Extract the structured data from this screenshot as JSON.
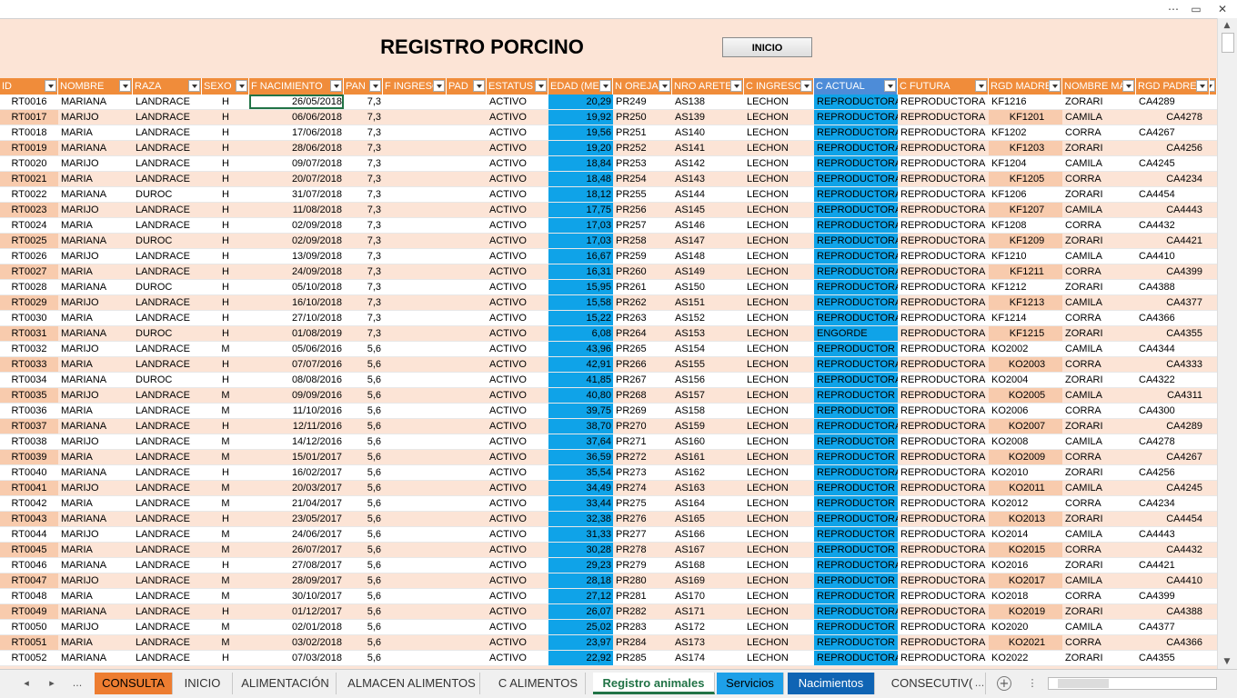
{
  "window": {
    "controls": [
      "⋯",
      "▭",
      "✕"
    ]
  },
  "sheet": {
    "title": "REGISTRO PORCINO",
    "button_label": "INICIO",
    "headers": [
      "ID",
      "NOMBRE",
      "RAZA",
      "SEXO",
      "F NACIMIENTO",
      "PAN",
      "F INGRESO",
      "PAD",
      "ESTATUS",
      "EDAD (ME",
      "N OREJA",
      "NRO ARETE",
      "C INGRESO",
      "C ACTUAL",
      "C FUTURA",
      "RGD MADRE",
      "NOMBRE MA",
      "RGD PADRE",
      ""
    ],
    "rows": [
      [
        "RT0016",
        "MARIANA",
        "LANDRACE",
        "H",
        "26/05/2018",
        "7,3",
        "",
        "",
        "ACTIVO",
        "20,29",
        "PR249",
        "AS138",
        "LECHON",
        "REPRODUCTORA",
        "REPRODUCTORA",
        "KF1216",
        "ZORARI",
        "CA4289"
      ],
      [
        "RT0017",
        "MARIJO",
        "LANDRACE",
        "H",
        "06/06/2018",
        "7,3",
        "",
        "",
        "ACTIVO",
        "19,92",
        "PR250",
        "AS139",
        "LECHON",
        "REPRODUCTORA",
        "REPRODUCTORA",
        "KF1201",
        "CAMILA",
        "CA4278"
      ],
      [
        "RT0018",
        "MARIA",
        "LANDRACE",
        "H",
        "17/06/2018",
        "7,3",
        "",
        "",
        "ACTIVO",
        "19,56",
        "PR251",
        "AS140",
        "LECHON",
        "REPRODUCTORA",
        "REPRODUCTORA",
        "KF1202",
        "CORRA",
        "CA4267"
      ],
      [
        "RT0019",
        "MARIANA",
        "LANDRACE",
        "H",
        "28/06/2018",
        "7,3",
        "",
        "",
        "ACTIVO",
        "19,20",
        "PR252",
        "AS141",
        "LECHON",
        "REPRODUCTORA",
        "REPRODUCTORA",
        "KF1203",
        "ZORARI",
        "CA4256"
      ],
      [
        "RT0020",
        "MARIJO",
        "LANDRACE",
        "H",
        "09/07/2018",
        "7,3",
        "",
        "",
        "ACTIVO",
        "18,84",
        "PR253",
        "AS142",
        "LECHON",
        "REPRODUCTORA",
        "REPRODUCTORA",
        "KF1204",
        "CAMILA",
        "CA4245"
      ],
      [
        "RT0021",
        "MARIA",
        "LANDRACE",
        "H",
        "20/07/2018",
        "7,3",
        "",
        "",
        "ACTIVO",
        "18,48",
        "PR254",
        "AS143",
        "LECHON",
        "REPRODUCTORA",
        "REPRODUCTORA",
        "KF1205",
        "CORRA",
        "CA4234"
      ],
      [
        "RT0022",
        "MARIANA",
        "DUROC",
        "H",
        "31/07/2018",
        "7,3",
        "",
        "",
        "ACTIVO",
        "18,12",
        "PR255",
        "AS144",
        "LECHON",
        "REPRODUCTORA",
        "REPRODUCTORA",
        "KF1206",
        "ZORARI",
        "CA4454"
      ],
      [
        "RT0023",
        "MARIJO",
        "LANDRACE",
        "H",
        "11/08/2018",
        "7,3",
        "",
        "",
        "ACTIVO",
        "17,75",
        "PR256",
        "AS145",
        "LECHON",
        "REPRODUCTORA",
        "REPRODUCTORA",
        "KF1207",
        "CAMILA",
        "CA4443"
      ],
      [
        "RT0024",
        "MARIA",
        "LANDRACE",
        "H",
        "02/09/2018",
        "7,3",
        "",
        "",
        "ACTIVO",
        "17,03",
        "PR257",
        "AS146",
        "LECHON",
        "REPRODUCTORA",
        "REPRODUCTORA",
        "KF1208",
        "CORRA",
        "CA4432"
      ],
      [
        "RT0025",
        "MARIANA",
        "DUROC",
        "H",
        "02/09/2018",
        "7,3",
        "",
        "",
        "ACTIVO",
        "17,03",
        "PR258",
        "AS147",
        "LECHON",
        "REPRODUCTORA",
        "REPRODUCTORA",
        "KF1209",
        "ZORARI",
        "CA4421"
      ],
      [
        "RT0026",
        "MARIJO",
        "LANDRACE",
        "H",
        "13/09/2018",
        "7,3",
        "",
        "",
        "ACTIVO",
        "16,67",
        "PR259",
        "AS148",
        "LECHON",
        "REPRODUCTORA",
        "REPRODUCTORA",
        "KF1210",
        "CAMILA",
        "CA4410"
      ],
      [
        "RT0027",
        "MARIA",
        "LANDRACE",
        "H",
        "24/09/2018",
        "7,3",
        "",
        "",
        "ACTIVO",
        "16,31",
        "PR260",
        "AS149",
        "LECHON",
        "REPRODUCTORA",
        "REPRODUCTORA",
        "KF1211",
        "CORRA",
        "CA4399"
      ],
      [
        "RT0028",
        "MARIANA",
        "DUROC",
        "H",
        "05/10/2018",
        "7,3",
        "",
        "",
        "ACTIVO",
        "15,95",
        "PR261",
        "AS150",
        "LECHON",
        "REPRODUCTORA",
        "REPRODUCTORA",
        "KF1212",
        "ZORARI",
        "CA4388"
      ],
      [
        "RT0029",
        "MARIJO",
        "LANDRACE",
        "H",
        "16/10/2018",
        "7,3",
        "",
        "",
        "ACTIVO",
        "15,58",
        "PR262",
        "AS151",
        "LECHON",
        "REPRODUCTORA",
        "REPRODUCTORA",
        "KF1213",
        "CAMILA",
        "CA4377"
      ],
      [
        "RT0030",
        "MARIA",
        "LANDRACE",
        "H",
        "27/10/2018",
        "7,3",
        "",
        "",
        "ACTIVO",
        "15,22",
        "PR263",
        "AS152",
        "LECHON",
        "REPRODUCTORA",
        "REPRODUCTORA",
        "KF1214",
        "CORRA",
        "CA4366"
      ],
      [
        "RT0031",
        "MARIANA",
        "DUROC",
        "H",
        "01/08/2019",
        "7,3",
        "",
        "",
        "ACTIVO",
        "6,08",
        "PR264",
        "AS153",
        "LECHON",
        "ENGORDE",
        "REPRODUCTORA",
        "KF1215",
        "ZORARI",
        "CA4355"
      ],
      [
        "RT0032",
        "MARIJO",
        "LANDRACE",
        "M",
        "05/06/2016",
        "5,6",
        "",
        "",
        "ACTIVO",
        "43,96",
        "PR265",
        "AS154",
        "LECHON",
        "REPRODUCTOR",
        "REPRODUCTORA",
        "KO2002",
        "CAMILA",
        "CA4344"
      ],
      [
        "RT0033",
        "MARIA",
        "LANDRACE",
        "H",
        "07/07/2016",
        "5,6",
        "",
        "",
        "ACTIVO",
        "42,91",
        "PR266",
        "AS155",
        "LECHON",
        "REPRODUCTORA",
        "REPRODUCTORA",
        "KO2003",
        "CORRA",
        "CA4333"
      ],
      [
        "RT0034",
        "MARIANA",
        "DUROC",
        "H",
        "08/08/2016",
        "5,6",
        "",
        "",
        "ACTIVO",
        "41,85",
        "PR267",
        "AS156",
        "LECHON",
        "REPRODUCTORA",
        "REPRODUCTORA",
        "KO2004",
        "ZORARI",
        "CA4322"
      ],
      [
        "RT0035",
        "MARIJO",
        "LANDRACE",
        "M",
        "09/09/2016",
        "5,6",
        "",
        "",
        "ACTIVO",
        "40,80",
        "PR268",
        "AS157",
        "LECHON",
        "REPRODUCTOR",
        "REPRODUCTORA",
        "KO2005",
        "CAMILA",
        "CA4311"
      ],
      [
        "RT0036",
        "MARIA",
        "LANDRACE",
        "M",
        "11/10/2016",
        "5,6",
        "",
        "",
        "ACTIVO",
        "39,75",
        "PR269",
        "AS158",
        "LECHON",
        "REPRODUCTOR",
        "REPRODUCTORA",
        "KO2006",
        "CORRA",
        "CA4300"
      ],
      [
        "RT0037",
        "MARIANA",
        "LANDRACE",
        "H",
        "12/11/2016",
        "5,6",
        "",
        "",
        "ACTIVO",
        "38,70",
        "PR270",
        "AS159",
        "LECHON",
        "REPRODUCTORA",
        "REPRODUCTORA",
        "KO2007",
        "ZORARI",
        "CA4289"
      ],
      [
        "RT0038",
        "MARIJO",
        "LANDRACE",
        "M",
        "14/12/2016",
        "5,6",
        "",
        "",
        "ACTIVO",
        "37,64",
        "PR271",
        "AS160",
        "LECHON",
        "REPRODUCTOR",
        "REPRODUCTORA",
        "KO2008",
        "CAMILA",
        "CA4278"
      ],
      [
        "RT0039",
        "MARIA",
        "LANDRACE",
        "M",
        "15/01/2017",
        "5,6",
        "",
        "",
        "ACTIVO",
        "36,59",
        "PR272",
        "AS161",
        "LECHON",
        "REPRODUCTOR",
        "REPRODUCTORA",
        "KO2009",
        "CORRA",
        "CA4267"
      ],
      [
        "RT0040",
        "MARIANA",
        "LANDRACE",
        "H",
        "16/02/2017",
        "5,6",
        "",
        "",
        "ACTIVO",
        "35,54",
        "PR273",
        "AS162",
        "LECHON",
        "REPRODUCTORA",
        "REPRODUCTORA",
        "KO2010",
        "ZORARI",
        "CA4256"
      ],
      [
        "RT0041",
        "MARIJO",
        "LANDRACE",
        "M",
        "20/03/2017",
        "5,6",
        "",
        "",
        "ACTIVO",
        "34,49",
        "PR274",
        "AS163",
        "LECHON",
        "REPRODUCTOR",
        "REPRODUCTORA",
        "KO2011",
        "CAMILA",
        "CA4245"
      ],
      [
        "RT0042",
        "MARIA",
        "LANDRACE",
        "M",
        "21/04/2017",
        "5,6",
        "",
        "",
        "ACTIVO",
        "33,44",
        "PR275",
        "AS164",
        "LECHON",
        "REPRODUCTOR",
        "REPRODUCTORA",
        "KO2012",
        "CORRA",
        "CA4234"
      ],
      [
        "RT0043",
        "MARIANA",
        "LANDRACE",
        "H",
        "23/05/2017",
        "5,6",
        "",
        "",
        "ACTIVO",
        "32,38",
        "PR276",
        "AS165",
        "LECHON",
        "REPRODUCTORA",
        "REPRODUCTORA",
        "KO2013",
        "ZORARI",
        "CA4454"
      ],
      [
        "RT0044",
        "MARIJO",
        "LANDRACE",
        "M",
        "24/06/2017",
        "5,6",
        "",
        "",
        "ACTIVO",
        "31,33",
        "PR277",
        "AS166",
        "LECHON",
        "REPRODUCTOR",
        "REPRODUCTORA",
        "KO2014",
        "CAMILA",
        "CA4443"
      ],
      [
        "RT0045",
        "MARIA",
        "LANDRACE",
        "M",
        "26/07/2017",
        "5,6",
        "",
        "",
        "ACTIVO",
        "30,28",
        "PR278",
        "AS167",
        "LECHON",
        "REPRODUCTOR",
        "REPRODUCTORA",
        "KO2015",
        "CORRA",
        "CA4432"
      ],
      [
        "RT0046",
        "MARIANA",
        "LANDRACE",
        "H",
        "27/08/2017",
        "5,6",
        "",
        "",
        "ACTIVO",
        "29,23",
        "PR279",
        "AS168",
        "LECHON",
        "REPRODUCTORA",
        "REPRODUCTORA",
        "KO2016",
        "ZORARI",
        "CA4421"
      ],
      [
        "RT0047",
        "MARIJO",
        "LANDRACE",
        "M",
        "28/09/2017",
        "5,6",
        "",
        "",
        "ACTIVO",
        "28,18",
        "PR280",
        "AS169",
        "LECHON",
        "REPRODUCTOR",
        "REPRODUCTORA",
        "KO2017",
        "CAMILA",
        "CA4410"
      ],
      [
        "RT0048",
        "MARIA",
        "LANDRACE",
        "M",
        "30/10/2017",
        "5,6",
        "",
        "",
        "ACTIVO",
        "27,12",
        "PR281",
        "AS170",
        "LECHON",
        "REPRODUCTOR",
        "REPRODUCTORA",
        "KO2018",
        "CORRA",
        "CA4399"
      ],
      [
        "RT0049",
        "MARIANA",
        "LANDRACE",
        "H",
        "01/12/2017",
        "5,6",
        "",
        "",
        "ACTIVO",
        "26,07",
        "PR282",
        "AS171",
        "LECHON",
        "REPRODUCTORA",
        "REPRODUCTORA",
        "KO2019",
        "ZORARI",
        "CA4388"
      ],
      [
        "RT0050",
        "MARIJO",
        "LANDRACE",
        "M",
        "02/01/2018",
        "5,6",
        "",
        "",
        "ACTIVO",
        "25,02",
        "PR283",
        "AS172",
        "LECHON",
        "REPRODUCTOR",
        "REPRODUCTORA",
        "KO2020",
        "CAMILA",
        "CA4377"
      ],
      [
        "RT0051",
        "MARIA",
        "LANDRACE",
        "M",
        "03/02/2018",
        "5,6",
        "",
        "",
        "ACTIVO",
        "23,97",
        "PR284",
        "AS173",
        "LECHON",
        "REPRODUCTOR",
        "REPRODUCTORA",
        "KO2021",
        "CORRA",
        "CA4366"
      ],
      [
        "RT0052",
        "MARIANA",
        "LANDRACE",
        "H",
        "07/03/2018",
        "5,6",
        "",
        "",
        "ACTIVO",
        "22,92",
        "PR285",
        "AS174",
        "LECHON",
        "REPRODUCTORA",
        "REPRODUCTORA",
        "KO2022",
        "ZORARI",
        "CA4355"
      ]
    ]
  },
  "tabs": {
    "nav": [
      "◂",
      "▸",
      "..."
    ],
    "items": [
      {
        "label": "CONSULTA",
        "style": "orange"
      },
      {
        "label": "INICIO",
        "style": "plain"
      },
      {
        "label": "ALIMENTACIÓN",
        "style": "plain"
      },
      {
        "label": "ALMACEN ALIMENTOS",
        "style": "plain"
      },
      {
        "label": "C ALIMENTOS",
        "style": "plain"
      },
      {
        "label": "Registro animales",
        "style": "active"
      },
      {
        "label": "Servicios",
        "style": "lblue"
      },
      {
        "label": "Nacimientos",
        "style": "dblue"
      },
      {
        "label": "CONSECUTIV(",
        "style": "plain"
      },
      {
        "label": "...",
        "style": "plain"
      }
    ],
    "add_label": "+"
  },
  "colors": {
    "header_orange": "#f08c3a",
    "header_blue": "#4d8cd8",
    "highlight_blue": "#0fa3e8",
    "row_pink": "#fce4d6",
    "active_tab_green": "#217346"
  }
}
